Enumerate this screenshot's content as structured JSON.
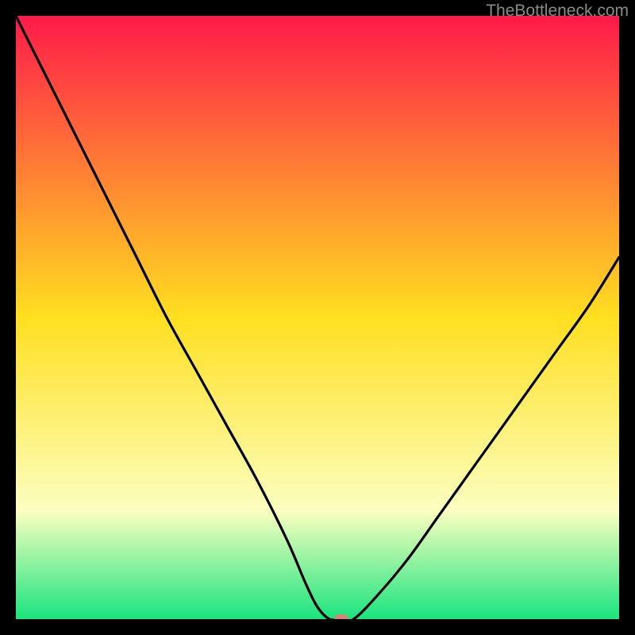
{
  "watermark": "TheBottleneck.com",
  "colors": {
    "frame": "#000000",
    "grad_top": "#ff1a4a",
    "grad_mid": "#ffdf20",
    "grad_low": "#fbffc0",
    "grad_bottom": "#19e57e",
    "curve": "#000000",
    "marker": "#d48374"
  },
  "chart_data": {
    "type": "line",
    "title": "",
    "xlabel": "",
    "ylabel": "",
    "xlim": [
      0,
      100
    ],
    "ylim": [
      0,
      100
    ],
    "series": [
      {
        "name": "bottleneck-curve",
        "x": [
          0,
          5,
          10,
          15,
          20,
          25,
          30,
          35,
          40,
          45,
          48,
          50,
          52,
          54,
          56,
          60,
          65,
          70,
          75,
          80,
          85,
          90,
          95,
          100
        ],
        "values": [
          100,
          90,
          80,
          70,
          60,
          50,
          41,
          32,
          23,
          13,
          6,
          2,
          0,
          0,
          0,
          4,
          10,
          17,
          24,
          31,
          38,
          45,
          52,
          60
        ]
      }
    ],
    "marker": {
      "x": 54,
      "y": 0
    },
    "gradient_stops": [
      {
        "pct": 0,
        "color": "#ff1a4a"
      },
      {
        "pct": 50,
        "color": "#ffdf20"
      },
      {
        "pct": 82,
        "color": "#fbffc0"
      },
      {
        "pct": 100,
        "color": "#19e57e"
      }
    ]
  }
}
